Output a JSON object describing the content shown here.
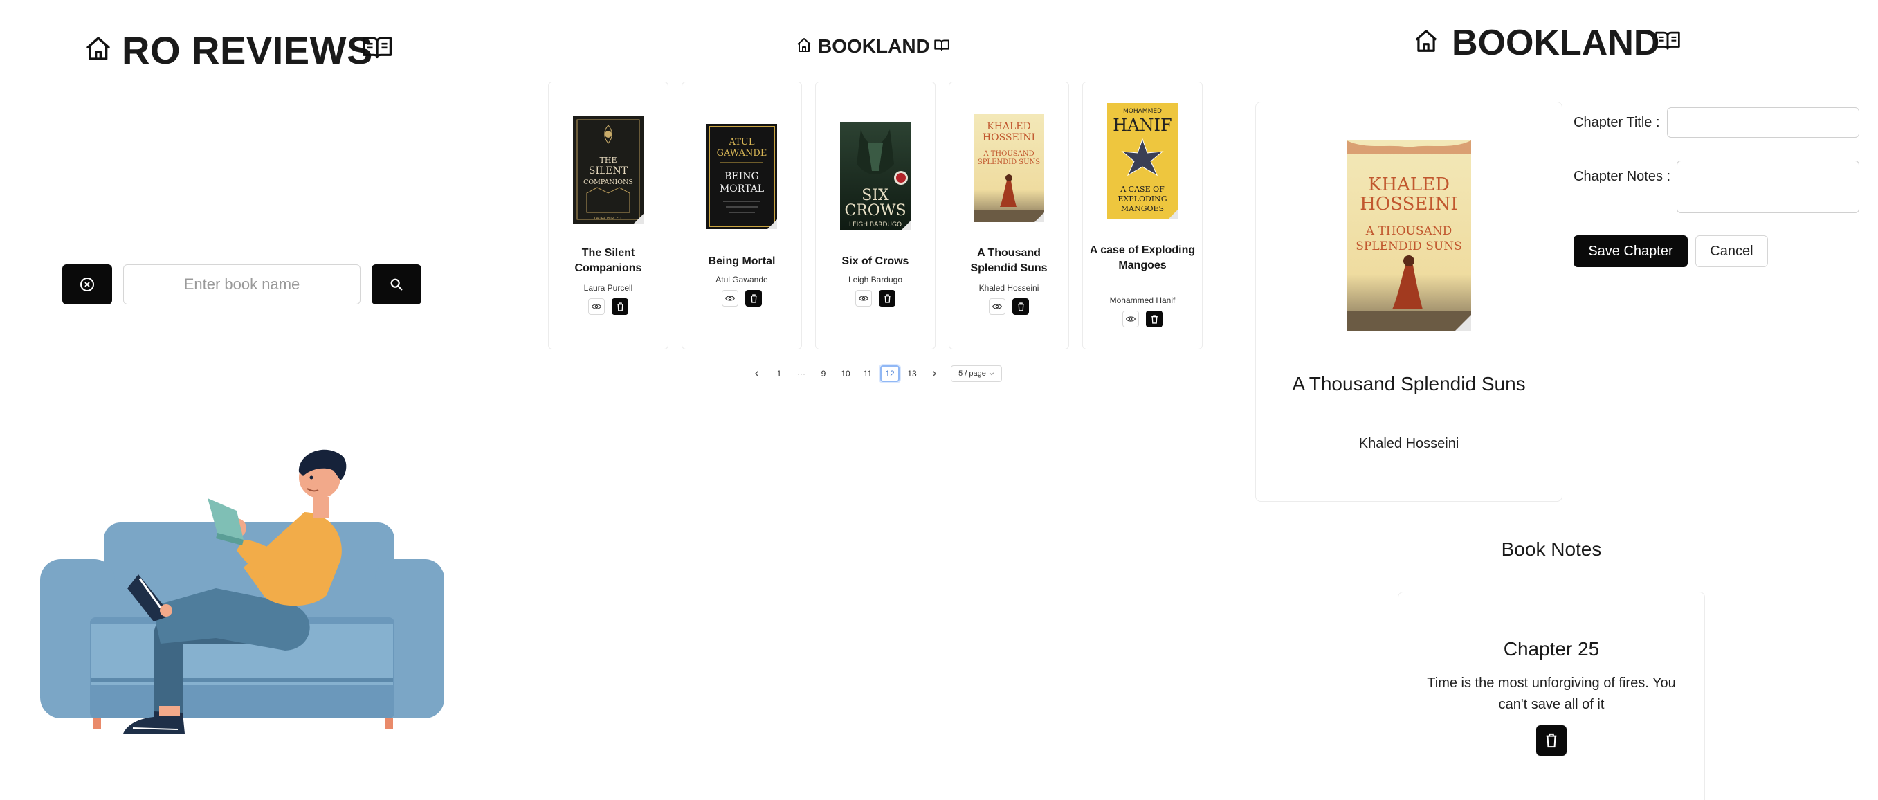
{
  "panel1": {
    "title": "RO REVIEWS",
    "search": {
      "placeholder": "Enter book name",
      "value": ""
    }
  },
  "panel2": {
    "title": "BOOKLAND",
    "books": [
      {
        "title": "The Silent Companions",
        "author": "Laura Purcell",
        "cover_lines": [
          "THE",
          "SILENT",
          "COMPANIONS",
          "LAURA PURCELL"
        ]
      },
      {
        "title": "Being Mortal",
        "author": "Atul Gawande",
        "cover_lines": [
          "ATUL",
          "GAWANDE",
          "BEING",
          "MORTAL"
        ]
      },
      {
        "title": "Six of Crows",
        "author": "Leigh Bardugo",
        "cover_lines": [
          "SIX",
          "CROWS",
          "LEIGH BARDUGO"
        ]
      },
      {
        "title": "A Thousand Splendid Suns",
        "author": "Khaled Hosseini",
        "cover_lines": [
          "KHALED",
          "HOSSEINI",
          "A THOUSAND",
          "SPLENDID SUNS"
        ]
      },
      {
        "title": "A case of Exploding Mangoes",
        "author": "Mohammed Hanif",
        "cover_lines": [
          "MOHAMMED",
          "HANIF",
          "A CASE OF",
          "EXPLODING",
          "MANGOES"
        ]
      }
    ],
    "pagination": {
      "pages": [
        "1",
        "···",
        "9",
        "10",
        "11",
        "12",
        "13"
      ],
      "current": "12",
      "page_size": "5 / page"
    }
  },
  "panel3": {
    "title": "BOOKLAND",
    "book": {
      "title": "A Thousand Splendid Suns",
      "author": "Khaled Hosseini",
      "cover_lines": [
        "KHALED",
        "HOSSEINI",
        "A THOUSAND",
        "SPLENDID SUNS"
      ]
    },
    "form": {
      "chapter_title_label": "Chapter Title :",
      "chapter_notes_label": "Chapter Notes :",
      "chapter_title_value": "",
      "chapter_notes_value": "",
      "save_label": "Save Chapter",
      "cancel_label": "Cancel"
    },
    "notes_heading": "Book Notes",
    "note": {
      "title": "Chapter 25",
      "text": "Time is the most unforgiving of fires. You can't save all of it"
    }
  }
}
